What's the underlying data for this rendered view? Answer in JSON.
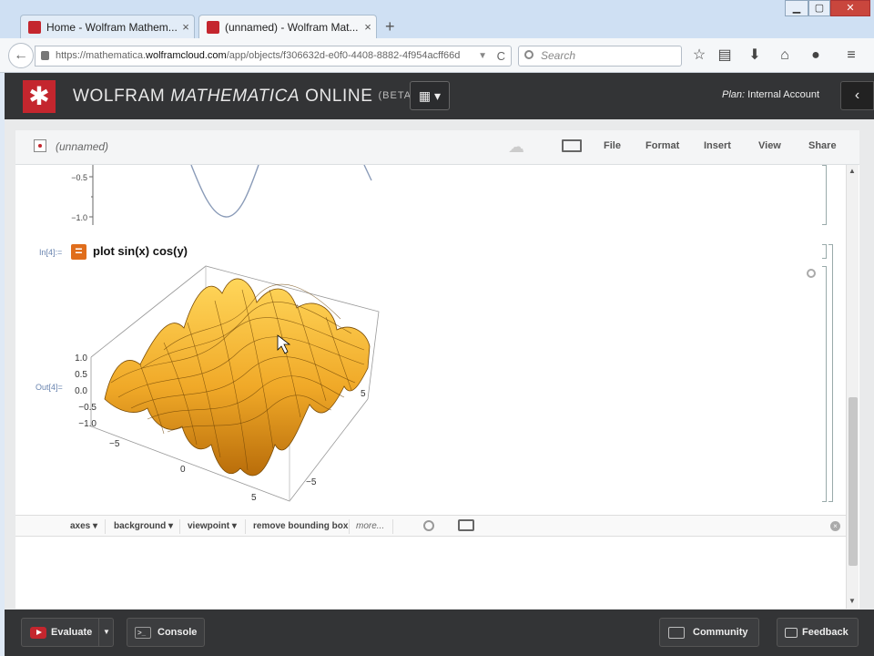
{
  "browser": {
    "tabs": [
      {
        "title": "Home - Wolfram Mathem...",
        "close": "×"
      },
      {
        "title": "(unnamed) - Wolfram Mat...",
        "close": "×"
      }
    ],
    "new_tab": "+",
    "window_controls": {
      "minimize": "▁",
      "maximize": "▢",
      "close": "✕"
    },
    "url_prefix": "https://mathematica.",
    "url_host": "wolframcloud.com",
    "url_rest": "/app/objects/f306632d-e0f0-4408-8882-4f954acff66d",
    "search_placeholder": "Search",
    "back": "←",
    "reload": "C",
    "dropdown": "▼",
    "toolbar_icons": [
      "star-icon",
      "reading-list-icon",
      "download-icon",
      "home-icon",
      "chat-icon",
      "menu-icon"
    ],
    "toolbar_glyphs": [
      "☆",
      "▤",
      "⬇",
      "⌂",
      "●",
      "≡"
    ]
  },
  "app": {
    "brand": "WOLFRAM",
    "product": "MATHEMATICA",
    "suffix": "ONLINE",
    "beta": "(BETA)",
    "layout_glyph": "▦ ▾",
    "plan_label": "Plan:",
    "plan_value": "Internal Account",
    "side_glyph": "‹",
    "accent": "#c4262e"
  },
  "notebook": {
    "name": "(unnamed)",
    "menu": [
      "File",
      "Format",
      "Insert",
      "View",
      "Share"
    ],
    "in_label": "In[4]:=",
    "out_label": "Out[4]=",
    "input": "plot sin(x) cos(y)",
    "top_plot_ticks": [
      "−0.5",
      "−1.0"
    ],
    "z_ticks": [
      "1.0",
      "0.5",
      "0.0",
      "−0.5",
      "−1.0"
    ],
    "x_ticks": [
      "−5",
      "0",
      "5"
    ],
    "y_ticks": [
      "−5",
      "5"
    ],
    "surface_color": "#f0a928"
  },
  "suggestions": {
    "items": [
      "axes",
      "background",
      "viewpoint",
      "remove bounding box"
    ],
    "more": "more...",
    "close": "×"
  },
  "bottom": {
    "evaluate": "Evaluate",
    "evaluate_dropdown": "▼",
    "console": "Console",
    "console_glyph": ">_",
    "community": "Community",
    "feedback": "Feedback"
  }
}
